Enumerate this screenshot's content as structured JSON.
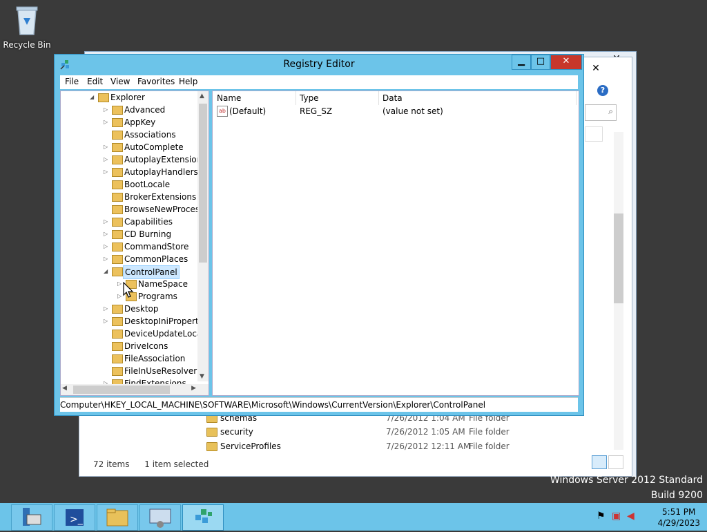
{
  "desktop": {
    "recycle_bin_label": "Recycle Bin"
  },
  "watermark": {
    "line1": "Windows Server 2012 Standard",
    "line2": "Build 9200"
  },
  "explorer": {
    "rows": [
      {
        "name": "schemas",
        "date": "7/26/2012 1:04 AM",
        "type": "File folder"
      },
      {
        "name": "security",
        "date": "7/26/2012 1:05 AM",
        "type": "File folder"
      },
      {
        "name": "ServiceProfiles",
        "date": "7/26/2012 12:11 AM",
        "type": "File folder"
      }
    ],
    "status_items": "72 items",
    "status_selected": "1 item selected"
  },
  "regedit": {
    "title": "Registry Editor",
    "menu": [
      "File",
      "Edit",
      "View",
      "Favorites",
      "Help"
    ],
    "tree": [
      {
        "label": "Explorer",
        "expanded": true
      },
      {
        "label": "Advanced"
      },
      {
        "label": "AppKey"
      },
      {
        "label": "Associations"
      },
      {
        "label": "AutoComplete"
      },
      {
        "label": "AutoplayExtensions"
      },
      {
        "label": "AutoplayHandlers"
      },
      {
        "label": "BootLocale"
      },
      {
        "label": "BrokerExtensions"
      },
      {
        "label": "BrowseNewProcess"
      },
      {
        "label": "Capabilities"
      },
      {
        "label": "CD Burning"
      },
      {
        "label": "CommandStore"
      },
      {
        "label": "CommonPlaces"
      },
      {
        "label": "ControlPanel",
        "selected": true,
        "expanded": true
      },
      {
        "label": "NameSpace"
      },
      {
        "label": "Programs"
      },
      {
        "label": "Desktop"
      },
      {
        "label": "DesktopIniProperty"
      },
      {
        "label": "DeviceUpdateLocat"
      },
      {
        "label": "DriveIcons"
      },
      {
        "label": "FileAssociation"
      },
      {
        "label": "FileInUseResolver"
      },
      {
        "label": "FindExtensions"
      }
    ],
    "columns": [
      "Name",
      "Type",
      "Data"
    ],
    "values": [
      {
        "name": "(Default)",
        "type": "REG_SZ",
        "data": "(value not set)"
      }
    ],
    "path": "Computer\\HKEY_LOCAL_MACHINE\\SOFTWARE\\Microsoft\\Windows\\CurrentVersion\\Explorer\\ControlPanel"
  },
  "taskbar": {
    "items": [
      "server-manager-icon",
      "powershell-icon",
      "file-explorer-icon",
      "control-panel-icon",
      "registry-editor-icon"
    ],
    "time": "5:51 PM",
    "date": "4/29/2023"
  }
}
